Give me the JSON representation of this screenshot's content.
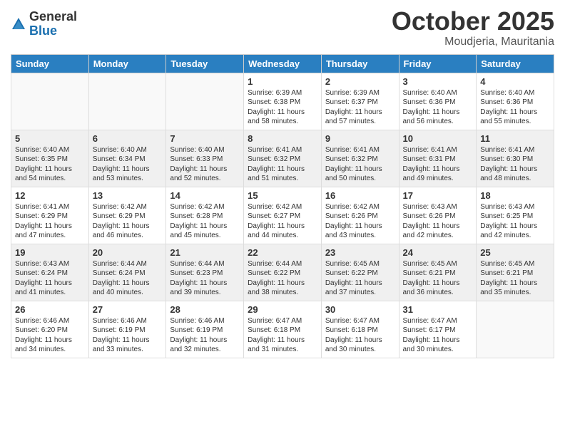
{
  "header": {
    "logo_general": "General",
    "logo_blue": "Blue",
    "month": "October 2025",
    "location": "Moudjeria, Mauritania"
  },
  "days_of_week": [
    "Sunday",
    "Monday",
    "Tuesday",
    "Wednesday",
    "Thursday",
    "Friday",
    "Saturday"
  ],
  "weeks": [
    [
      {
        "day": "",
        "info": ""
      },
      {
        "day": "",
        "info": ""
      },
      {
        "day": "",
        "info": ""
      },
      {
        "day": "1",
        "info": "Sunrise: 6:39 AM\nSunset: 6:38 PM\nDaylight: 11 hours\nand 58 minutes."
      },
      {
        "day": "2",
        "info": "Sunrise: 6:39 AM\nSunset: 6:37 PM\nDaylight: 11 hours\nand 57 minutes."
      },
      {
        "day": "3",
        "info": "Sunrise: 6:40 AM\nSunset: 6:36 PM\nDaylight: 11 hours\nand 56 minutes."
      },
      {
        "day": "4",
        "info": "Sunrise: 6:40 AM\nSunset: 6:36 PM\nDaylight: 11 hours\nand 55 minutes."
      }
    ],
    [
      {
        "day": "5",
        "info": "Sunrise: 6:40 AM\nSunset: 6:35 PM\nDaylight: 11 hours\nand 54 minutes."
      },
      {
        "day": "6",
        "info": "Sunrise: 6:40 AM\nSunset: 6:34 PM\nDaylight: 11 hours\nand 53 minutes."
      },
      {
        "day": "7",
        "info": "Sunrise: 6:40 AM\nSunset: 6:33 PM\nDaylight: 11 hours\nand 52 minutes."
      },
      {
        "day": "8",
        "info": "Sunrise: 6:41 AM\nSunset: 6:32 PM\nDaylight: 11 hours\nand 51 minutes."
      },
      {
        "day": "9",
        "info": "Sunrise: 6:41 AM\nSunset: 6:32 PM\nDaylight: 11 hours\nand 50 minutes."
      },
      {
        "day": "10",
        "info": "Sunrise: 6:41 AM\nSunset: 6:31 PM\nDaylight: 11 hours\nand 49 minutes."
      },
      {
        "day": "11",
        "info": "Sunrise: 6:41 AM\nSunset: 6:30 PM\nDaylight: 11 hours\nand 48 minutes."
      }
    ],
    [
      {
        "day": "12",
        "info": "Sunrise: 6:41 AM\nSunset: 6:29 PM\nDaylight: 11 hours\nand 47 minutes."
      },
      {
        "day": "13",
        "info": "Sunrise: 6:42 AM\nSunset: 6:29 PM\nDaylight: 11 hours\nand 46 minutes."
      },
      {
        "day": "14",
        "info": "Sunrise: 6:42 AM\nSunset: 6:28 PM\nDaylight: 11 hours\nand 45 minutes."
      },
      {
        "day": "15",
        "info": "Sunrise: 6:42 AM\nSunset: 6:27 PM\nDaylight: 11 hours\nand 44 minutes."
      },
      {
        "day": "16",
        "info": "Sunrise: 6:42 AM\nSunset: 6:26 PM\nDaylight: 11 hours\nand 43 minutes."
      },
      {
        "day": "17",
        "info": "Sunrise: 6:43 AM\nSunset: 6:26 PM\nDaylight: 11 hours\nand 42 minutes."
      },
      {
        "day": "18",
        "info": "Sunrise: 6:43 AM\nSunset: 6:25 PM\nDaylight: 11 hours\nand 42 minutes."
      }
    ],
    [
      {
        "day": "19",
        "info": "Sunrise: 6:43 AM\nSunset: 6:24 PM\nDaylight: 11 hours\nand 41 minutes."
      },
      {
        "day": "20",
        "info": "Sunrise: 6:44 AM\nSunset: 6:24 PM\nDaylight: 11 hours\nand 40 minutes."
      },
      {
        "day": "21",
        "info": "Sunrise: 6:44 AM\nSunset: 6:23 PM\nDaylight: 11 hours\nand 39 minutes."
      },
      {
        "day": "22",
        "info": "Sunrise: 6:44 AM\nSunset: 6:22 PM\nDaylight: 11 hours\nand 38 minutes."
      },
      {
        "day": "23",
        "info": "Sunrise: 6:45 AM\nSunset: 6:22 PM\nDaylight: 11 hours\nand 37 minutes."
      },
      {
        "day": "24",
        "info": "Sunrise: 6:45 AM\nSunset: 6:21 PM\nDaylight: 11 hours\nand 36 minutes."
      },
      {
        "day": "25",
        "info": "Sunrise: 6:45 AM\nSunset: 6:21 PM\nDaylight: 11 hours\nand 35 minutes."
      }
    ],
    [
      {
        "day": "26",
        "info": "Sunrise: 6:46 AM\nSunset: 6:20 PM\nDaylight: 11 hours\nand 34 minutes."
      },
      {
        "day": "27",
        "info": "Sunrise: 6:46 AM\nSunset: 6:19 PM\nDaylight: 11 hours\nand 33 minutes."
      },
      {
        "day": "28",
        "info": "Sunrise: 6:46 AM\nSunset: 6:19 PM\nDaylight: 11 hours\nand 32 minutes."
      },
      {
        "day": "29",
        "info": "Sunrise: 6:47 AM\nSunset: 6:18 PM\nDaylight: 11 hours\nand 31 minutes."
      },
      {
        "day": "30",
        "info": "Sunrise: 6:47 AM\nSunset: 6:18 PM\nDaylight: 11 hours\nand 30 minutes."
      },
      {
        "day": "31",
        "info": "Sunrise: 6:47 AM\nSunset: 6:17 PM\nDaylight: 11 hours\nand 30 minutes."
      },
      {
        "day": "",
        "info": ""
      }
    ]
  ]
}
